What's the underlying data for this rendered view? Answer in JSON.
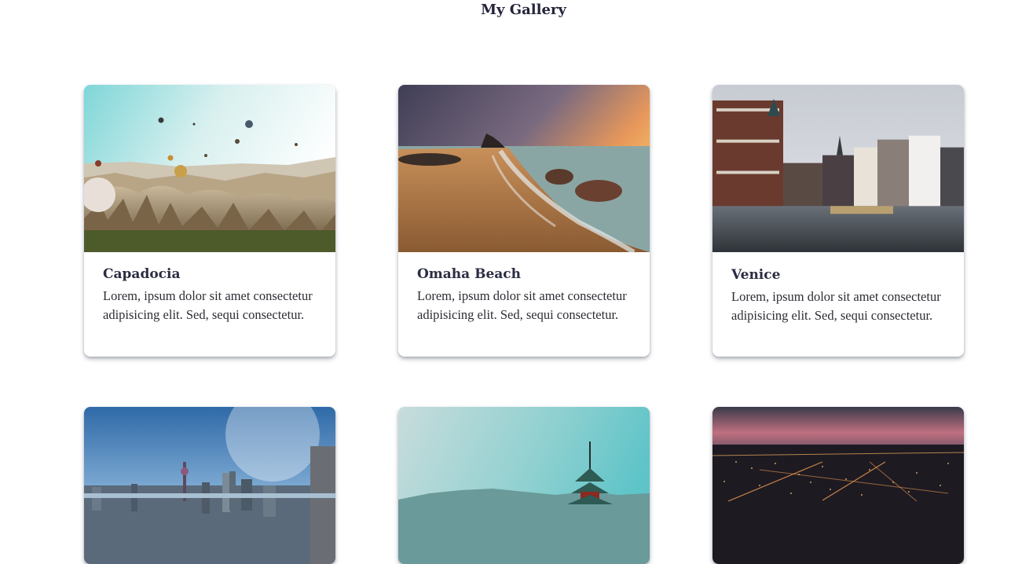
{
  "page": {
    "title": "My Gallery"
  },
  "gallery": {
    "cards": [
      {
        "title": "Capadocia",
        "text": "Lorem, ipsum dolor sit amet consectetur adipisicing elit. Sed, sequi consectetur.",
        "image_icon": "hot-air-balloons-landscape-photo"
      },
      {
        "title": "Omaha Beach",
        "text": "Lorem, ipsum dolor sit amet consectetur adipisicing elit. Sed, sequi consectetur.",
        "image_icon": "beach-sunset-photo"
      },
      {
        "title": "Venice",
        "text": "Lorem, ipsum dolor sit amet consectetur adipisicing elit. Sed, sequi consectetur.",
        "image_icon": "canal-city-photo"
      },
      {
        "image_icon": "city-skyline-photo"
      },
      {
        "image_icon": "pagoda-photo"
      },
      {
        "image_icon": "city-lights-night-photo"
      }
    ]
  }
}
